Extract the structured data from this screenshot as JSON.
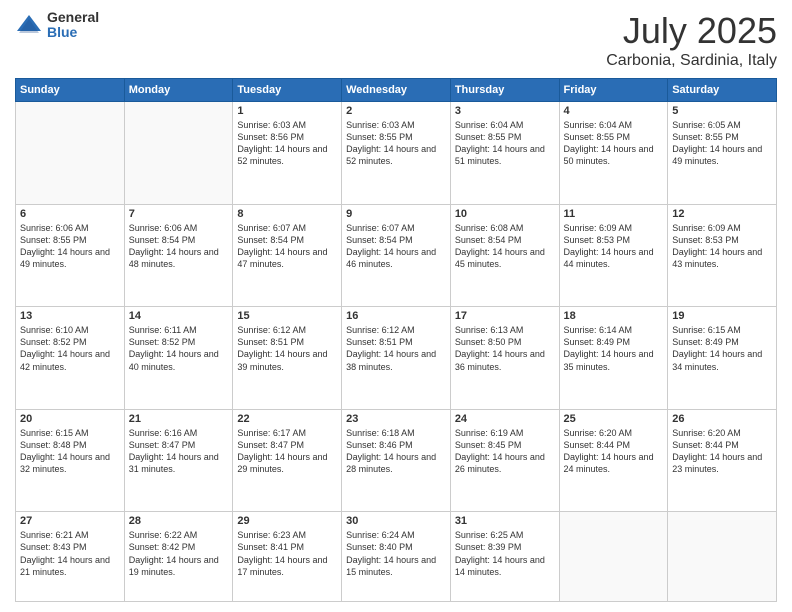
{
  "logo": {
    "general": "General",
    "blue": "Blue"
  },
  "header": {
    "title": "July 2025",
    "subtitle": "Carbonia, Sardinia, Italy"
  },
  "days_of_week": [
    "Sunday",
    "Monday",
    "Tuesday",
    "Wednesday",
    "Thursday",
    "Friday",
    "Saturday"
  ],
  "weeks": [
    [
      {
        "day": "",
        "info": ""
      },
      {
        "day": "",
        "info": ""
      },
      {
        "day": "1",
        "info": "Sunrise: 6:03 AM\nSunset: 8:56 PM\nDaylight: 14 hours and 52 minutes."
      },
      {
        "day": "2",
        "info": "Sunrise: 6:03 AM\nSunset: 8:55 PM\nDaylight: 14 hours and 52 minutes."
      },
      {
        "day": "3",
        "info": "Sunrise: 6:04 AM\nSunset: 8:55 PM\nDaylight: 14 hours and 51 minutes."
      },
      {
        "day": "4",
        "info": "Sunrise: 6:04 AM\nSunset: 8:55 PM\nDaylight: 14 hours and 50 minutes."
      },
      {
        "day": "5",
        "info": "Sunrise: 6:05 AM\nSunset: 8:55 PM\nDaylight: 14 hours and 49 minutes."
      }
    ],
    [
      {
        "day": "6",
        "info": "Sunrise: 6:06 AM\nSunset: 8:55 PM\nDaylight: 14 hours and 49 minutes."
      },
      {
        "day": "7",
        "info": "Sunrise: 6:06 AM\nSunset: 8:54 PM\nDaylight: 14 hours and 48 minutes."
      },
      {
        "day": "8",
        "info": "Sunrise: 6:07 AM\nSunset: 8:54 PM\nDaylight: 14 hours and 47 minutes."
      },
      {
        "day": "9",
        "info": "Sunrise: 6:07 AM\nSunset: 8:54 PM\nDaylight: 14 hours and 46 minutes."
      },
      {
        "day": "10",
        "info": "Sunrise: 6:08 AM\nSunset: 8:54 PM\nDaylight: 14 hours and 45 minutes."
      },
      {
        "day": "11",
        "info": "Sunrise: 6:09 AM\nSunset: 8:53 PM\nDaylight: 14 hours and 44 minutes."
      },
      {
        "day": "12",
        "info": "Sunrise: 6:09 AM\nSunset: 8:53 PM\nDaylight: 14 hours and 43 minutes."
      }
    ],
    [
      {
        "day": "13",
        "info": "Sunrise: 6:10 AM\nSunset: 8:52 PM\nDaylight: 14 hours and 42 minutes."
      },
      {
        "day": "14",
        "info": "Sunrise: 6:11 AM\nSunset: 8:52 PM\nDaylight: 14 hours and 40 minutes."
      },
      {
        "day": "15",
        "info": "Sunrise: 6:12 AM\nSunset: 8:51 PM\nDaylight: 14 hours and 39 minutes."
      },
      {
        "day": "16",
        "info": "Sunrise: 6:12 AM\nSunset: 8:51 PM\nDaylight: 14 hours and 38 minutes."
      },
      {
        "day": "17",
        "info": "Sunrise: 6:13 AM\nSunset: 8:50 PM\nDaylight: 14 hours and 36 minutes."
      },
      {
        "day": "18",
        "info": "Sunrise: 6:14 AM\nSunset: 8:49 PM\nDaylight: 14 hours and 35 minutes."
      },
      {
        "day": "19",
        "info": "Sunrise: 6:15 AM\nSunset: 8:49 PM\nDaylight: 14 hours and 34 minutes."
      }
    ],
    [
      {
        "day": "20",
        "info": "Sunrise: 6:15 AM\nSunset: 8:48 PM\nDaylight: 14 hours and 32 minutes."
      },
      {
        "day": "21",
        "info": "Sunrise: 6:16 AM\nSunset: 8:47 PM\nDaylight: 14 hours and 31 minutes."
      },
      {
        "day": "22",
        "info": "Sunrise: 6:17 AM\nSunset: 8:47 PM\nDaylight: 14 hours and 29 minutes."
      },
      {
        "day": "23",
        "info": "Sunrise: 6:18 AM\nSunset: 8:46 PM\nDaylight: 14 hours and 28 minutes."
      },
      {
        "day": "24",
        "info": "Sunrise: 6:19 AM\nSunset: 8:45 PM\nDaylight: 14 hours and 26 minutes."
      },
      {
        "day": "25",
        "info": "Sunrise: 6:20 AM\nSunset: 8:44 PM\nDaylight: 14 hours and 24 minutes."
      },
      {
        "day": "26",
        "info": "Sunrise: 6:20 AM\nSunset: 8:44 PM\nDaylight: 14 hours and 23 minutes."
      }
    ],
    [
      {
        "day": "27",
        "info": "Sunrise: 6:21 AM\nSunset: 8:43 PM\nDaylight: 14 hours and 21 minutes."
      },
      {
        "day": "28",
        "info": "Sunrise: 6:22 AM\nSunset: 8:42 PM\nDaylight: 14 hours and 19 minutes."
      },
      {
        "day": "29",
        "info": "Sunrise: 6:23 AM\nSunset: 8:41 PM\nDaylight: 14 hours and 17 minutes."
      },
      {
        "day": "30",
        "info": "Sunrise: 6:24 AM\nSunset: 8:40 PM\nDaylight: 14 hours and 15 minutes."
      },
      {
        "day": "31",
        "info": "Sunrise: 6:25 AM\nSunset: 8:39 PM\nDaylight: 14 hours and 14 minutes."
      },
      {
        "day": "",
        "info": ""
      },
      {
        "day": "",
        "info": ""
      }
    ]
  ]
}
